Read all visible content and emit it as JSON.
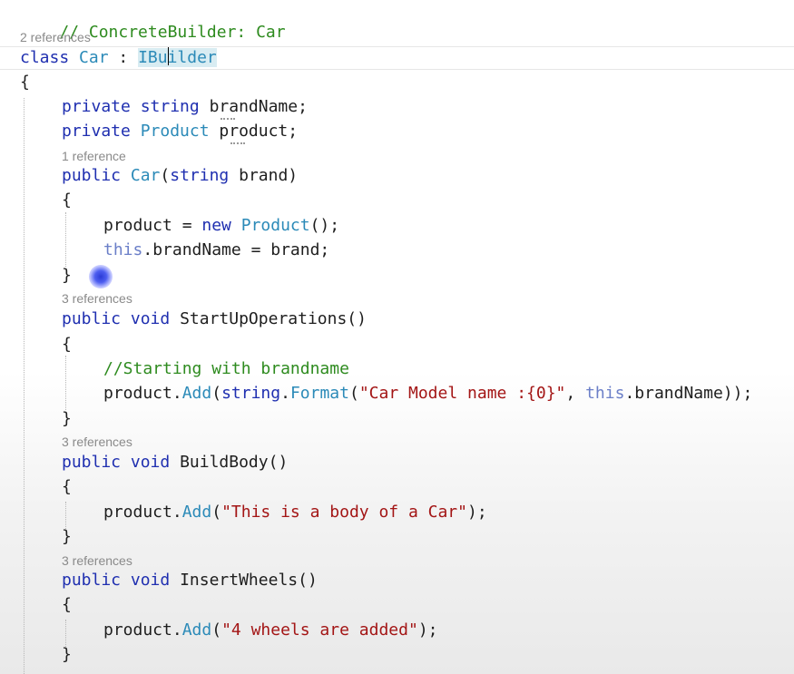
{
  "code": {
    "comment_header": "// ConcreteBuilder: Car",
    "refs_class": "2 references",
    "class_kw": "class",
    "class_name": "Car",
    "colon": " : ",
    "base_before_caret": "IBu",
    "base_after_caret": "ilder",
    "open_brace": "{",
    "close_brace": "}",
    "private_kw": "private",
    "string_kw": "string",
    "field1_name": "brandName;",
    "product_type": "Product",
    "field2_name": "product;",
    "refs_ctor": "1 reference",
    "public_kw": "public",
    "ctor_name": "Car",
    "ctor_params_open": "(",
    "ctor_param_name": "brand)",
    "ctor_line1_a": "product = ",
    "new_kw": "new",
    "ctor_line1_b": "();",
    "this_kw": "this",
    "ctor_line2": ".brandName = brand;",
    "refs_m1": "3 references",
    "void_kw": "void",
    "m1_name": "StartUpOperations()",
    "m1_comment": "//Starting with brandname",
    "product_add": "product.",
    "add_fn": "Add",
    "paren_open": "(",
    "format_fn": "Format",
    "dot": ".",
    "m1_string": "\"Car Model name :{0}\"",
    "comma_space": ", ",
    "m1_tail": ".brandName));",
    "refs_m2": "3 references",
    "m2_name": "BuildBody()",
    "m2_string": "\"This is a body of a Car\"",
    "call_end": ");",
    "refs_m3": "3 references",
    "m3_name": "InsertWheels()",
    "m3_string": "\"4 wheels are added\""
  },
  "colors": {
    "keyword": "#1f2fb0",
    "type": "#2b8ab8",
    "string": "#a31515",
    "comment": "#2e8b1f",
    "reference_hint": "#8a8a8a",
    "cursor_highlight": "#2b3bd6"
  }
}
